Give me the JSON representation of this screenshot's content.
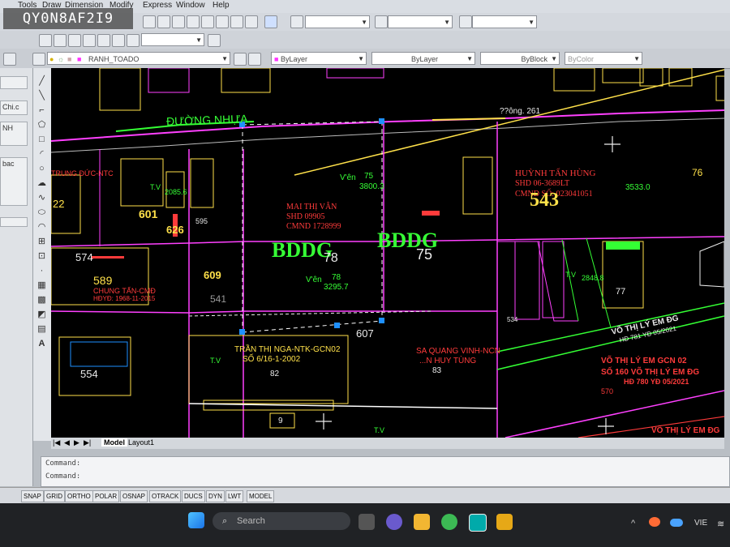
{
  "watermark": "QY0N8AF2I9",
  "menu": [
    "Tools",
    "Draw",
    "Dimension",
    "Modify",
    "Express",
    "Window",
    "Help"
  ],
  "toolbar": {
    "layer_name": "RANH_TOADO",
    "color": "ByLayer",
    "linetype": "ByLayer",
    "lineweight": "ByBlock",
    "plotstyle": "ByColor"
  },
  "left_panel": [
    "Chi.c",
    "NH",
    "bac"
  ],
  "drawing": {
    "road": "ĐƯỜNG NHỰA",
    "road_right": "??ông. 261",
    "parcels": [
      "601",
      "626",
      "595",
      "574",
      "589",
      "609",
      "541",
      "607",
      "543",
      "534",
      "554",
      "76",
      "77",
      "82",
      "83",
      "9",
      "22",
      "78",
      "75"
    ],
    "owners": {
      "mai_name": "MAI THỊ VÂN",
      "mai_shd": "SHD 09905",
      "mai_cmnd": "CMND 1728999",
      "huynh_name": "HUỲNH TẤN HÙNG",
      "huynh_shd": "SHD 06-3689LT",
      "huynh_cmnd": "CMND SỐ: 023041051",
      "chung_name": "CHUNG TẤN-CMĐ",
      "chung_hd": "HĐYĐ: 1968-11-2015",
      "trung_name": "TRUNG ĐỨC-NTC",
      "tran_name": "TRẦN THỊ NGA-NTK-GCN02",
      "tran_sub": "SỐ 6/16-1-2002",
      "vinh_name": "SA QUANG VINH-NCN",
      "vinh_sub": "...N HUY TÙNG",
      "vo1_name": "VÕ THỊ LÝ EM ĐG",
      "vo1_sub": "HĐ 781 YĐ 05/2021",
      "vo2_name": "VÕ THỊ LÝ EM GCN 02",
      "vo2_sub1": "SỐ 160 VÕ THỊ LÝ EM ĐG",
      "vo2_sub2": "HĐ 780 YĐ 05/2021",
      "vo2_num": "570",
      "vo3": "VÕ THỊ LÝ EM ĐG"
    },
    "bddg1": "BDDG",
    "bddg2": "BDDG",
    "areas": {
      "a1_label": "V'ên",
      "a1_val": "75",
      "a1_area": "3800.3",
      "a2_label": "V'ên",
      "a2_val": "78",
      "a2_area": "3295.7",
      "a3_val": "3533.0",
      "a4_val": "2085.6",
      "a5_val": "2848.8",
      "tv1": "T.V",
      "tv2": "T.V",
      "tv3": "T.V",
      "tv4": "T.V"
    }
  },
  "tabs": [
    "Model",
    "Layout1"
  ],
  "command_lines": [
    "Command:",
    "Command:"
  ],
  "status": [
    "SNAP",
    "GRID",
    "ORTHO",
    "POLAR",
    "OSNAP",
    "OTRACK",
    "DUCS",
    "DYN",
    "LWT",
    "MODEL"
  ],
  "taskbar": {
    "search": "Search",
    "lang": "VIE"
  }
}
